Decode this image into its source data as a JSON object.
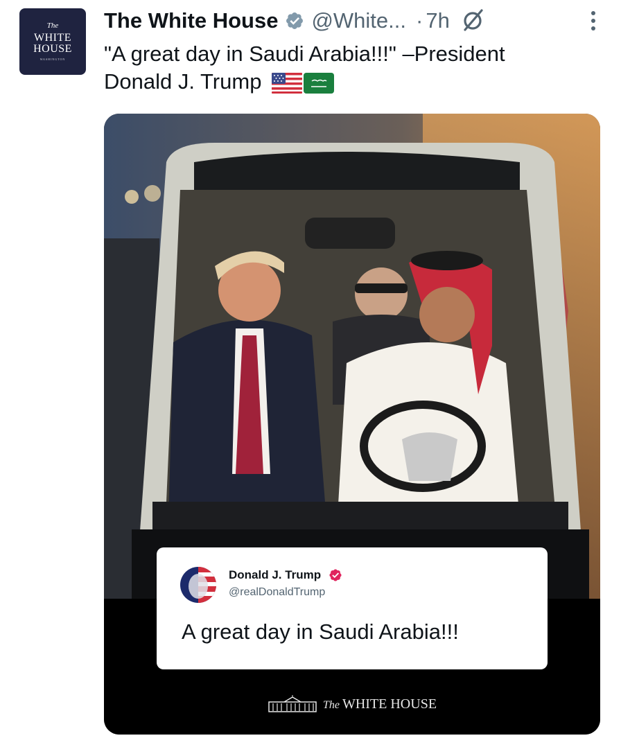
{
  "author": {
    "avatar_text_the": "The",
    "avatar_text_main_1": "WHITE",
    "avatar_text_main_2": "HOUSE",
    "avatar_text_sub": "WASHINGTON",
    "display_name": "The White House",
    "handle": "@White...",
    "separator": "·",
    "timestamp": "7h"
  },
  "tweet": {
    "text_line_1": "\"A great day in Saudi Arabia!!!\" –President",
    "text_line_2": "Donald J. Trump",
    "flags": [
      "us-flag-icon",
      "saudi-flag-icon"
    ]
  },
  "media": {
    "quote_card": {
      "name": "Donald J. Trump",
      "handle": "@realDonaldTrump",
      "text": "A great day in Saudi Arabia!!!"
    },
    "footer": {
      "the": "The",
      "label": "WHITE HOUSE"
    }
  },
  "colors": {
    "verified_gold": "#829aab",
    "quote_verified": "#e0245e",
    "avatar_bg": "#1f2340",
    "text_secondary": "#536471"
  },
  "icons": [
    "verified-badge-icon",
    "grok-icon",
    "more-options-icon",
    "white-house-building-icon"
  ]
}
